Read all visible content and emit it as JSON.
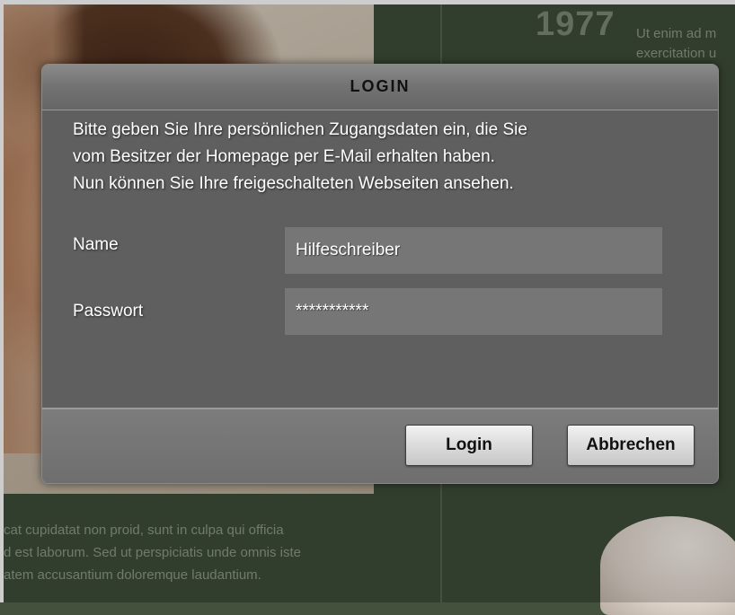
{
  "background": {
    "year": "1977",
    "right_snippets": [
      "Ut enim ad m",
      "exercitation u"
    ],
    "bottom_text": [
      "cat cupidatat non proid, sunt in culpa qui officia",
      "d est laborum. Sed ut perspiciatis unde omnis iste",
      "atem accusantium doloremque laudantium."
    ]
  },
  "dialog": {
    "title": "LOGIN",
    "intro_lines": [
      "Bitte geben Sie Ihre persönlichen Zugangsdaten ein, die Sie",
      "vom Besitzer der Homepage per E-Mail erhalten haben.",
      "Nun können Sie Ihre freigeschalteten Webseiten ansehen."
    ],
    "name_label": "Name",
    "name_value": "Hilfeschreiber",
    "password_label": "Passwort",
    "password_value": "***********",
    "login_button": "Login",
    "cancel_button": "Abbrechen"
  },
  "colors": {
    "page_bg": "#3e4c37",
    "dialog_bg": "#5f5f5f",
    "input_bg": "#767676"
  }
}
